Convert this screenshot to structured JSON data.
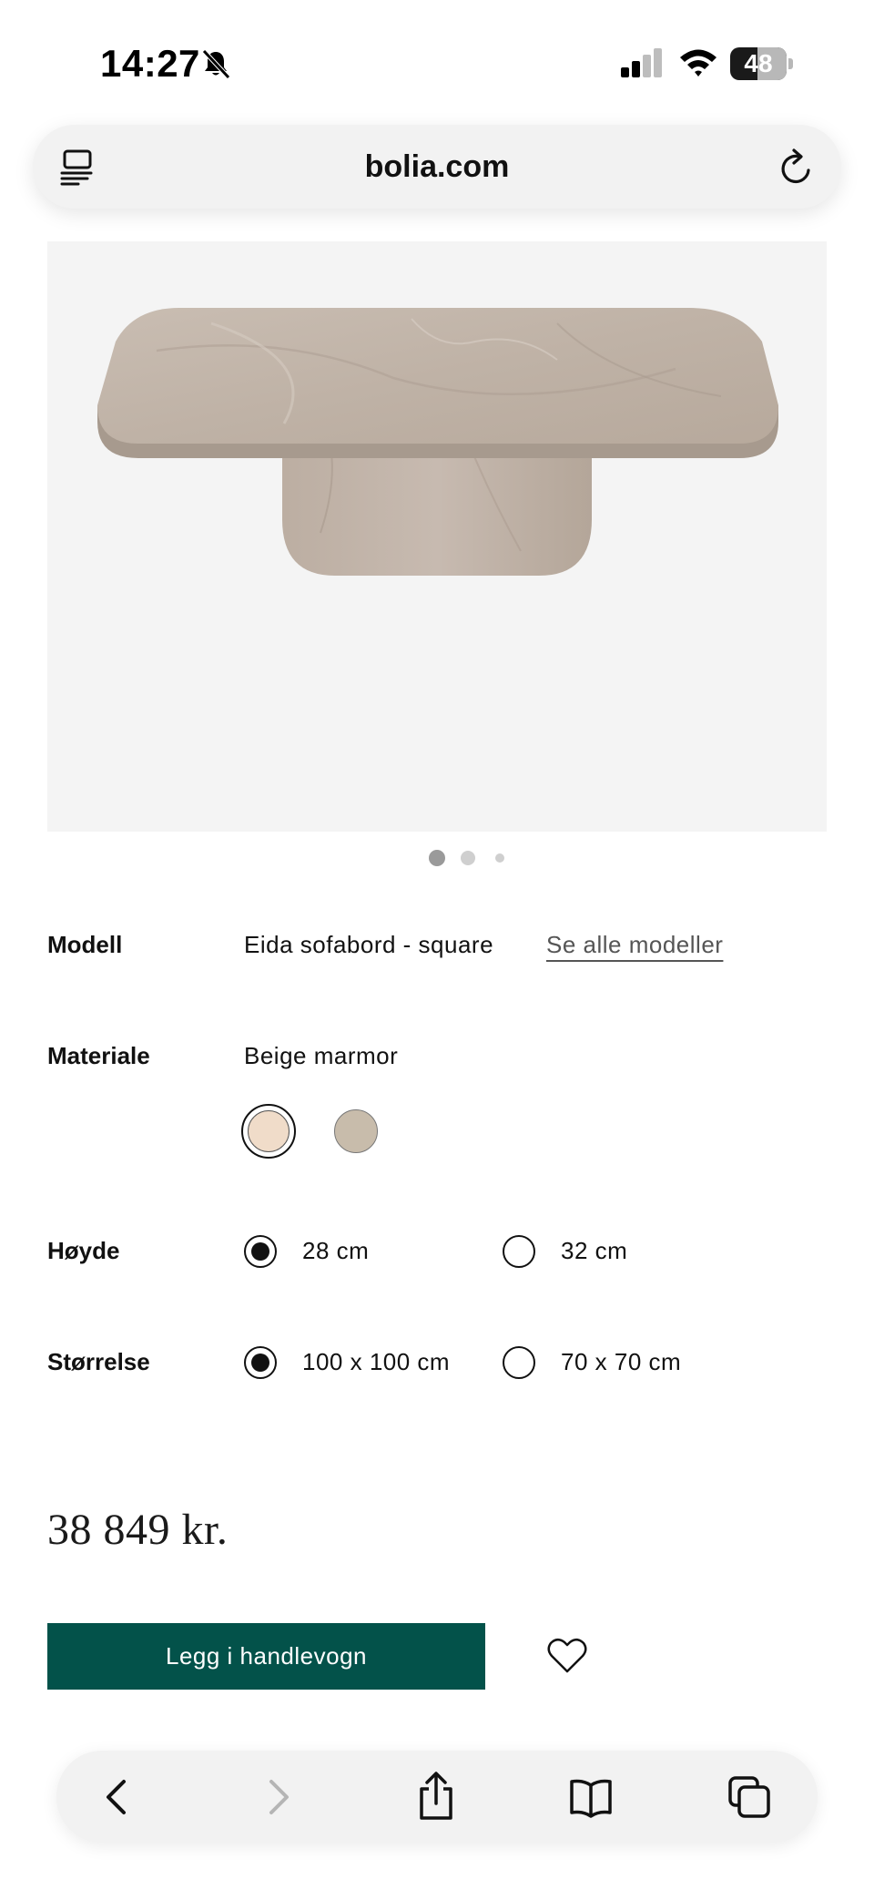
{
  "status_bar": {
    "time": "14:27",
    "battery_level": "48",
    "battery_fraction": 0.48,
    "icons": [
      "bell-slash-icon",
      "cellular-signal-icon",
      "wifi-icon",
      "battery-icon"
    ]
  },
  "browser": {
    "url": "bolia.com",
    "icons": [
      "reader-mode-icon",
      "reload-icon"
    ]
  },
  "gallery": {
    "image_alt": "",
    "slides_total": 3,
    "active_index": 0
  },
  "product": {
    "model_label": "Modell",
    "model_value": "Eida sofabord - square",
    "see_all_models": "Se alle modeller",
    "material_label": "Materiale",
    "material_value": "Beige marmor",
    "material_swatches": [
      {
        "color": "#f0dcc9",
        "selected": true
      },
      {
        "color": "#c8bcab",
        "selected": false
      }
    ],
    "height_label": "Høyde",
    "height_options": [
      {
        "label": "28 cm",
        "selected": true
      },
      {
        "label": "32 cm",
        "selected": false
      }
    ],
    "size_label": "Størrelse",
    "size_options": [
      {
        "label": "100 x 100 cm",
        "selected": true
      },
      {
        "label": "70 x 70 cm",
        "selected": false
      }
    ],
    "price": "38 849 kr.",
    "add_to_cart": "Legg i handlevogn",
    "accent_color": "#03524a"
  },
  "toolbar": {
    "buttons": [
      "back-icon",
      "forward-icon",
      "share-icon",
      "bookmarks-icon",
      "tabs-icon"
    ]
  }
}
